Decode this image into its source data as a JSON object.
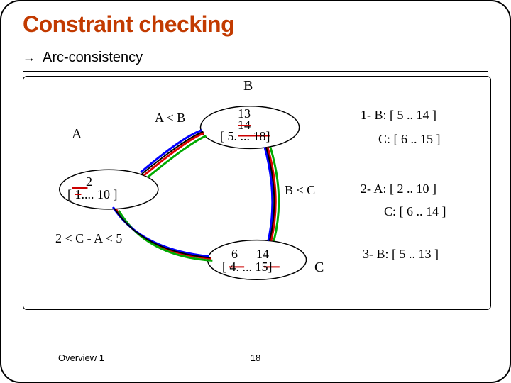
{
  "title": "Constraint checking",
  "bullet": "Arc-consistency",
  "nodes": {
    "A": {
      "label": "A",
      "new_lower": "2",
      "old_lower": "1",
      "range_rest": ".... 10 ]"
    },
    "B": {
      "label": "B",
      "top_val": "13",
      "struck_val": "14",
      "range": "[ 5. ... 18]"
    },
    "C": {
      "label": "C",
      "lower": "6",
      "upper": "14",
      "range": "[ 4. ... 15]"
    }
  },
  "edges": {
    "AB": "A < B",
    "BC": "B < C",
    "CA": "2 < C - A < 5"
  },
  "steps": {
    "s1b": "1- B: [ 5 .. 14 ]",
    "s1c": "C:  [ 6 .. 15 ]",
    "s2a": "2- A: [ 2 .. 10 ]",
    "s2c": "C: [ 6 .. 14 ]",
    "s3b": "3- B: [ 5 .. 13 ]"
  },
  "footer": {
    "left": "Overview 1",
    "page": "18"
  }
}
